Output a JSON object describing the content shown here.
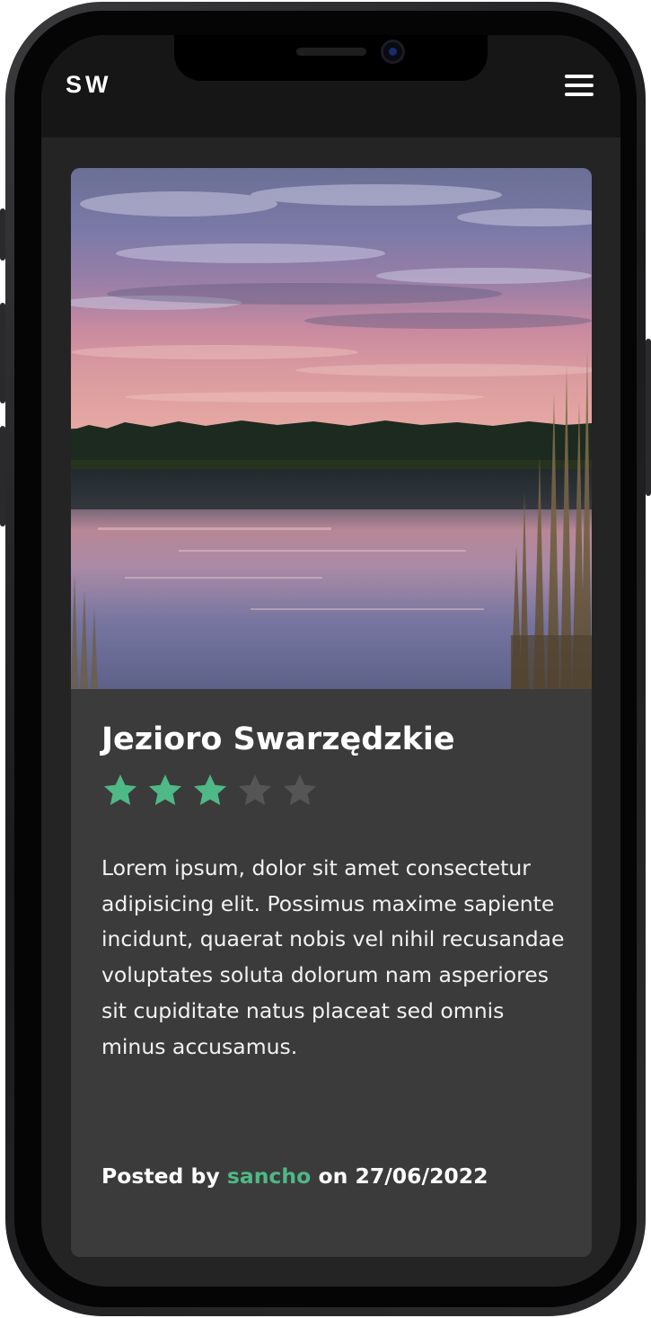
{
  "header": {
    "logo": "SW",
    "menu_icon": "hamburger-menu-icon"
  },
  "post": {
    "image": "lake-sunset-photo",
    "title": "Jezioro Swarzędzkie",
    "rating": 3,
    "rating_max": 5,
    "description": "Lorem ipsum, dolor sit amet consectetur adipisicing elit. Possimus maxime sapiente incidunt, quaerat nobis vel nihil recusandae voluptates soluta dolorum nam asperiores sit cupiditate natus placeat sed omnis minus accusamus.",
    "posted_by_prefix": "Posted by",
    "author": "sancho",
    "date_prefix": "on",
    "date": "27/06/2022"
  },
  "colors": {
    "accent": "#4fb887",
    "star_filled": "#4fb887",
    "star_empty": "#555555",
    "card": "#3b3b3b",
    "background": "#242424",
    "header": "#161616"
  }
}
